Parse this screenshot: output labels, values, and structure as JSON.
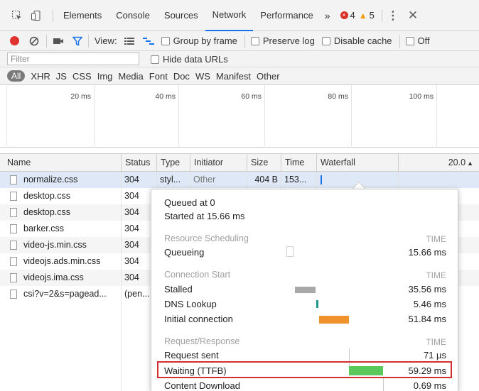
{
  "tabs": {
    "items": [
      "Elements",
      "Console",
      "Sources",
      "Network",
      "Performance"
    ],
    "active": "Network",
    "more": "»",
    "errors": "4",
    "warnings": "5",
    "colors": {
      "active_tab": "#1a73e8",
      "error": "#d93025",
      "warning": "#f29900"
    }
  },
  "toolbar": {
    "view_label": "View:",
    "group_by_frame": "Group by frame",
    "preserve_log": "Preserve log",
    "disable_cache": "Disable cache",
    "offline": "Off"
  },
  "filter": {
    "placeholder": "Filter",
    "hide_data_urls": "Hide data URLs"
  },
  "types": {
    "all": "All",
    "items": [
      "XHR",
      "JS",
      "CSS",
      "Img",
      "Media",
      "Font",
      "Doc",
      "WS",
      "Manifest",
      "Other"
    ]
  },
  "overview": {
    "ticks": [
      "20 ms",
      "40 ms",
      "60 ms",
      "80 ms",
      "100 ms"
    ]
  },
  "table": {
    "columns": [
      "Name",
      "Status",
      "Type",
      "Initiator",
      "Size",
      "Time",
      "Waterfall"
    ],
    "waterfall_scale": "20.0",
    "rows": [
      {
        "name": "normalize.css",
        "status": "304",
        "type": "styl...",
        "initiator": "Other",
        "size": "404 B",
        "time": "153..."
      },
      {
        "name": "desktop.css",
        "status": "304"
      },
      {
        "name": "desktop.css",
        "status": "304"
      },
      {
        "name": "barker.css",
        "status": "304"
      },
      {
        "name": "video-js.min.css",
        "status": "304"
      },
      {
        "name": "videojs.ads.min.css",
        "status": "304"
      },
      {
        "name": "videojs.ima.css",
        "status": "304"
      },
      {
        "name": "csi?v=2&s=pagead...",
        "status": "(pen..."
      }
    ]
  },
  "timing": {
    "queued": "Queued at 0",
    "started": "Started at 15.66 ms",
    "time_header": "TIME",
    "resource_scheduling": {
      "title": "Resource Scheduling",
      "queueing_label": "Queueing",
      "queueing_value": "15.66 ms"
    },
    "connection_start": {
      "title": "Connection Start",
      "stalled_label": "Stalled",
      "stalled_value": "35.56 ms",
      "dns_label": "DNS Lookup",
      "dns_value": "5.46 ms",
      "initial_label": "Initial connection",
      "initial_value": "51.84 ms"
    },
    "request_response": {
      "title": "Request/Response",
      "sent_label": "Request sent",
      "sent_value": "71 µs",
      "waiting_label": "Waiting (TTFB)",
      "waiting_value": "59.29 ms",
      "download_label": "Content Download",
      "download_value": "0.69 ms"
    },
    "colors": {
      "stalled": "#a8a8a8",
      "dns": "#1f9a8a",
      "initial": "#f0922b",
      "waiting": "#5ac85a",
      "highlight": "#d32f2f"
    }
  }
}
